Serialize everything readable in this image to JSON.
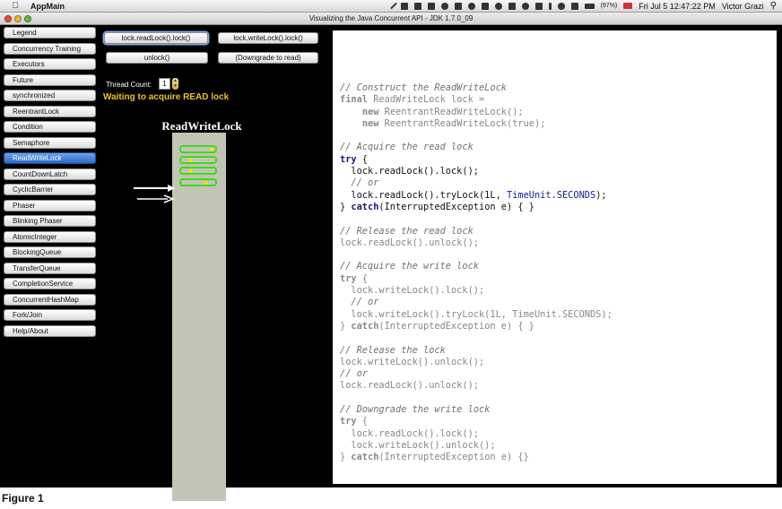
{
  "menubar": {
    "app_name": "AppMain",
    "battery": "(97%)",
    "clock": "Fri Jul 5  12:47:22 PM",
    "user": "Victor Grazi"
  },
  "window": {
    "title": "Visualizing the Java Concurrent API - JDK 1.7.0_09"
  },
  "sidebar": {
    "items": [
      {
        "label": "Legend",
        "active": false
      },
      {
        "label": "Concurrency Training",
        "active": false
      },
      {
        "label": "Executors",
        "active": false
      },
      {
        "label": "Future",
        "active": false
      },
      {
        "label": "synchronized",
        "active": false
      },
      {
        "label": "ReentrantLock",
        "active": false
      },
      {
        "label": "Condition",
        "active": false
      },
      {
        "label": "Semaphore",
        "active": false
      },
      {
        "label": "ReadWriteLock",
        "active": true
      },
      {
        "label": "CountDownLatch",
        "active": false
      },
      {
        "label": "CyclicBarrier",
        "active": false
      },
      {
        "label": "Phaser",
        "active": false
      },
      {
        "label": "Blinking Phaser",
        "active": false
      },
      {
        "label": "AtomicInteger",
        "active": false
      },
      {
        "label": "BlockingQueue",
        "active": false
      },
      {
        "label": "TransferQueue",
        "active": false
      },
      {
        "label": "CompletionService",
        "active": false
      },
      {
        "label": "ConcurrentHashMap",
        "active": false
      },
      {
        "label": "Fork/Join",
        "active": false
      },
      {
        "label": "Help/About",
        "active": false
      }
    ]
  },
  "controls": {
    "read_lock_label": "lock.readLock().lock()",
    "write_lock_label": "lock.writeLock().lock()",
    "unlock_label": "unlock()",
    "downgrade_label": "(Downgrade to read)",
    "thread_count_label": "Thread Count:",
    "thread_count_value": "1",
    "status": "Waiting to acquire READ lock"
  },
  "visual": {
    "title": "ReadWriteLock",
    "reader_count": 4,
    "colors": {
      "track": "#c4c4b6",
      "reader": "#3ddc1c",
      "status": "#f0c020"
    }
  },
  "code": {
    "lines": [
      [
        {
          "t": "// Construct the ReadWriteLock",
          "c": "comment"
        }
      ],
      [
        {
          "t": "final",
          "c": "kw"
        },
        {
          "t": " ReadWriteLock lock =",
          "c": "plain"
        }
      ],
      [
        {
          "t": "    ",
          "c": "plain"
        },
        {
          "t": "new",
          "c": "kw"
        },
        {
          "t": " ReentrantReadWriteLock();",
          "c": "plain"
        }
      ],
      [
        {
          "t": "    ",
          "c": "plain"
        },
        {
          "t": "new",
          "c": "kw"
        },
        {
          "t": " ReentrantReadWriteLock(true);",
          "c": "plain"
        }
      ],
      [],
      [
        {
          "t": "// Acquire the read lock",
          "c": "comment"
        }
      ],
      {
        "hl": true,
        "tokens": [
          {
            "t": "try",
            "c": "kw"
          },
          {
            "t": " {",
            "c": "plain"
          }
        ]
      },
      {
        "hl": true,
        "tokens": [
          {
            "t": "  lock.readLock().lock();",
            "c": "plain"
          }
        ]
      },
      {
        "hl": true,
        "tokens": [
          {
            "t": "  // or",
            "c": "comment"
          }
        ]
      },
      {
        "hl": true,
        "tokens": [
          {
            "t": "  lock.readLock().tryLock(1L, ",
            "c": "plain"
          },
          {
            "t": "TimeUnit.SECONDS",
            "c": "const"
          },
          {
            "t": ");",
            "c": "plain"
          }
        ]
      },
      {
        "hl": true,
        "tokens": [
          {
            "t": "} ",
            "c": "plain"
          },
          {
            "t": "catch",
            "c": "kw"
          },
          {
            "t": "(InterruptedException e) { }",
            "c": "plain"
          }
        ]
      },
      [],
      [
        {
          "t": "// Release the read lock",
          "c": "comment"
        }
      ],
      [
        {
          "t": "lock.readLock().unlock();",
          "c": "plain"
        }
      ],
      [],
      [
        {
          "t": "// Acquire the write lock",
          "c": "comment"
        }
      ],
      [
        {
          "t": "try",
          "c": "kw"
        },
        {
          "t": " {",
          "c": "plain"
        }
      ],
      [
        {
          "t": "  lock.writeLock().lock();",
          "c": "plain"
        }
      ],
      [
        {
          "t": "  // or",
          "c": "comment"
        }
      ],
      [
        {
          "t": "  lock.writeLock().tryLock(1L, TimeUnit.SECONDS);",
          "c": "plain"
        }
      ],
      [
        {
          "t": "} ",
          "c": "plain"
        },
        {
          "t": "catch",
          "c": "kw"
        },
        {
          "t": "(InterruptedException e) { }",
          "c": "plain"
        }
      ],
      [],
      [
        {
          "t": "// Release the lock",
          "c": "comment"
        }
      ],
      [
        {
          "t": "lock.writeLock().unlock();",
          "c": "plain"
        }
      ],
      [
        {
          "t": "// or",
          "c": "comment"
        }
      ],
      [
        {
          "t": "lock.readLock().unlock();",
          "c": "plain"
        }
      ],
      [],
      [
        {
          "t": "// Downgrade the write lock",
          "c": "comment"
        }
      ],
      [
        {
          "t": "try",
          "c": "kw"
        },
        {
          "t": " {",
          "c": "plain"
        }
      ],
      [
        {
          "t": "  lock.readLock().lock();",
          "c": "plain"
        }
      ],
      [
        {
          "t": "  lock.writeLock().unlock();",
          "c": "plain"
        }
      ],
      [
        {
          "t": "} ",
          "c": "plain"
        },
        {
          "t": "catch",
          "c": "kw"
        },
        {
          "t": "(InterruptedException e) {}",
          "c": "plain"
        }
      ]
    ]
  },
  "caption": "Figure 1"
}
